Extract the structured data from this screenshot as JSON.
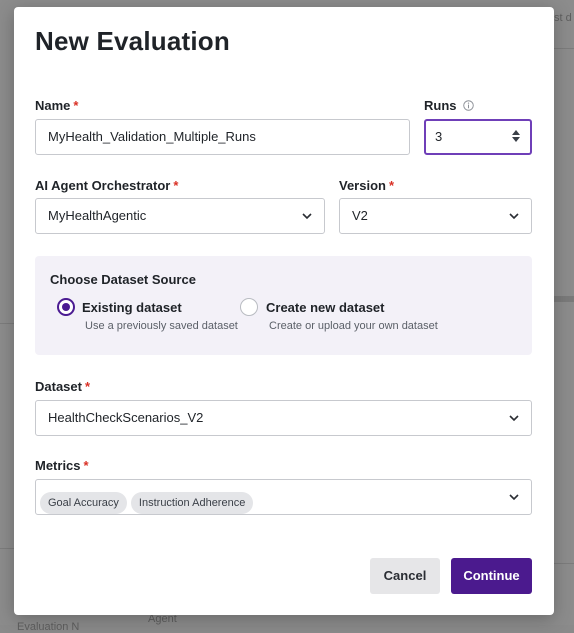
{
  "background": {
    "top_right_text": "st d",
    "bottom_left_text": "Evaluation N",
    "bottom_agent_text": "Agent"
  },
  "modal": {
    "title": "New Evaluation",
    "name": {
      "label": "Name",
      "required": "*",
      "value": "MyHealth_Validation_Multiple_Runs"
    },
    "runs": {
      "label": "Runs",
      "value": "3"
    },
    "orchestrator": {
      "label": "AI Agent Orchestrator",
      "required": "*",
      "value": "MyHealthAgentic"
    },
    "version": {
      "label": "Version",
      "required": "*",
      "value": "V2"
    },
    "dataset_source": {
      "title": "Choose Dataset Source",
      "options": [
        {
          "label": "Existing dataset",
          "help": "Use a previously saved dataset",
          "selected": true
        },
        {
          "label": "Create new dataset",
          "help": "Create or upload your own dataset",
          "selected": false
        }
      ]
    },
    "dataset": {
      "label": "Dataset",
      "required": "*",
      "value": "HealthCheckScenarios_V2"
    },
    "metrics": {
      "label": "Metrics",
      "required": "*",
      "chips": [
        "Goal Accuracy",
        "Instruction Adherence"
      ]
    },
    "buttons": {
      "cancel": "Cancel",
      "continue": "Continue"
    }
  },
  "colors": {
    "accent": "#4b1a8e",
    "focus_border": "#6f3fb8",
    "required": "#d93025",
    "source_bg": "#f3f1f8"
  }
}
